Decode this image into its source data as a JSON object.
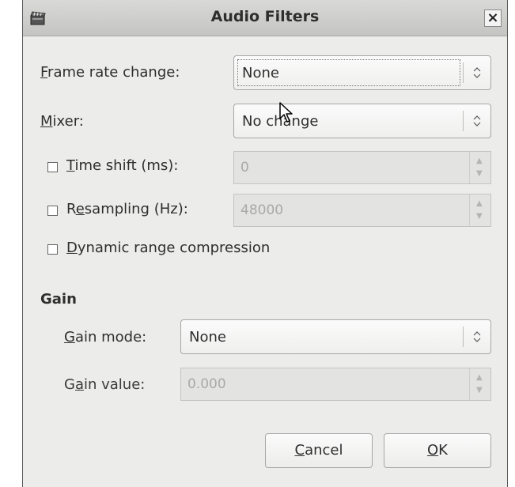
{
  "window": {
    "title": "Audio Filters",
    "close_glyph": "×",
    "icon": "clapperboard-icon"
  },
  "frame_rate": {
    "label_mnemonic": "F",
    "label_rest": "rame rate change:",
    "value": "None"
  },
  "mixer": {
    "label_mnemonic": "M",
    "label_rest": "ixer:",
    "value": "No change"
  },
  "time_shift": {
    "label_mnemonic": "T",
    "label_rest": "ime shift (ms):",
    "value": "0",
    "checked": false
  },
  "resampling": {
    "label_pre": "R",
    "label_mnemonic": "e",
    "label_rest": "sampling (Hz):",
    "value": "48000",
    "checked": false
  },
  "drc": {
    "label_mnemonic": "D",
    "label_rest": "ynamic range compression",
    "checked": false
  },
  "gain": {
    "section_title": "Gain",
    "mode": {
      "label_mnemonic": "G",
      "label_rest": "ain mode:",
      "value": "None"
    },
    "value": {
      "label_pre": "G",
      "label_mnemonic": "a",
      "label_rest": "in value:",
      "value": "0.000"
    }
  },
  "buttons": {
    "cancel": {
      "mnemonic": "C",
      "rest": "ancel"
    },
    "ok": {
      "mnemonic": "O",
      "rest": "K"
    }
  },
  "colors": {
    "window_bg": "#ececeb",
    "titlebar": "#cfcfcd",
    "disabled_text": "#a9a9a7"
  }
}
